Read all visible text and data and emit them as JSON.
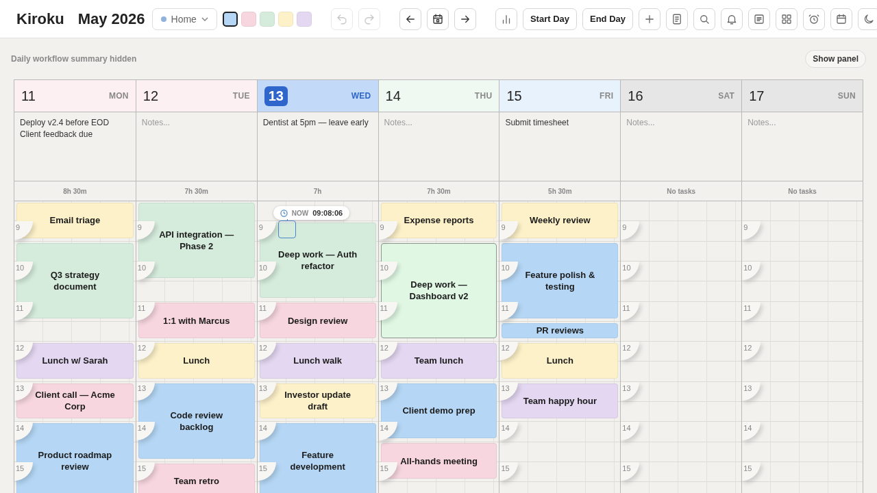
{
  "app": {
    "name": "Kiroku",
    "period": "May 2026"
  },
  "workspace": {
    "value": "Home"
  },
  "swatches": [
    {
      "color": "#b5d7f5",
      "selected": true
    },
    {
      "color": "#f7d6df",
      "selected": false
    },
    {
      "color": "#d5ebdc",
      "selected": false
    },
    {
      "color": "#fdf1c9",
      "selected": false
    },
    {
      "color": "#e3d7f1",
      "selected": false
    }
  ],
  "history": [
    {
      "kind": "icon",
      "disabled": true
    },
    {
      "kind": "icon",
      "disabled": true
    }
  ],
  "navigation": [
    {
      "kind": "icon"
    },
    {
      "kind": "icon"
    },
    {
      "kind": "icon"
    }
  ],
  "actions": [
    {
      "kind": "icon"
    },
    {
      "kind": "text",
      "label": "Start Day"
    },
    {
      "kind": "text",
      "label": "End Day"
    },
    {
      "kind": "icon"
    },
    {
      "kind": "icon"
    },
    {
      "kind": "icon"
    },
    {
      "kind": "icon"
    },
    {
      "kind": "icon"
    },
    {
      "kind": "icon"
    },
    {
      "kind": "icon"
    },
    {
      "kind": "icon"
    },
    {
      "kind": "icon"
    }
  ],
  "summary": {
    "text": "Daily workflow summary hidden",
    "button": "Show panel"
  },
  "days": [
    {
      "date": "11",
      "weekday": "MON",
      "color": "#fdf0f3",
      "today": false,
      "notes": "Deploy v2.4 before EOD\nClient feedback due",
      "total": "8h 30m",
      "hour_marks": [
        "9",
        "10",
        "11",
        "12",
        "13",
        "14",
        "15"
      ],
      "events": [
        {
          "title": "Email triage",
          "color": "#fdf1c9",
          "selected": false
        },
        {
          "title": "Q3 strategy document",
          "color": "#d5ebdc",
          "selected": false
        },
        {
          "title": "Lunch w/ Sarah",
          "color": "#e3d7f1",
          "selected": false
        },
        {
          "title": "Client call — Acme Corp",
          "color": "#f7d6df",
          "selected": false
        },
        {
          "title": "Product roadmap review",
          "color": "#b5d7f5",
          "selected": false
        }
      ]
    },
    {
      "date": "12",
      "weekday": "TUE",
      "color": "#fdf0f3",
      "today": false,
      "placeholder": "Notes...",
      "total": "7h 30m",
      "hour_marks": [
        "9",
        "10",
        "11",
        "12",
        "13",
        "14",
        "15"
      ],
      "events": [
        {
          "title": "API integration — Phase 2",
          "color": "#d5ebdc",
          "selected": false
        },
        {
          "title": "1:1 with Marcus",
          "color": "#f7d6df",
          "selected": false
        },
        {
          "title": "Lunch",
          "color": "#fdf1c9",
          "selected": false
        },
        {
          "title": "Code review backlog",
          "color": "#b5d7f5",
          "selected": false
        },
        {
          "title": "Team retro",
          "color": "#f7d6df",
          "selected": false
        }
      ]
    },
    {
      "date": "13",
      "weekday": "WED",
      "color": "#c2d9f7",
      "today": true,
      "notes": "Dentist at 5pm — leave early",
      "total": "7h",
      "hour_marks": [
        "9",
        "10",
        "11",
        "12",
        "13",
        "14",
        "15"
      ],
      "now": {
        "label": "NOW",
        "time": "09:08:06"
      },
      "events": [
        {
          "title": "Deep work — Auth refactor",
          "color": "#d5ebdc",
          "selected": false
        },
        {
          "title": "Design review",
          "color": "#f7d6df",
          "selected": false
        },
        {
          "title": "Lunch walk",
          "color": "#e3d7f1",
          "selected": false
        },
        {
          "title": "Investor update draft",
          "color": "#fdf1c9",
          "selected": false
        },
        {
          "title": "Feature development",
          "color": "#b5d7f5",
          "selected": false
        }
      ]
    },
    {
      "date": "14",
      "weekday": "THU",
      "color": "#eff8f1",
      "today": false,
      "placeholder": "Notes...",
      "total": "7h 30m",
      "hour_marks": [
        "9",
        "10",
        "11",
        "12",
        "13",
        "14",
        "15"
      ],
      "events": [
        {
          "title": "Expense reports",
          "color": "#fdf1c9",
          "selected": false
        },
        {
          "title": "Deep work — Dashboard v2",
          "color": "#dff7e3",
          "selected": true
        },
        {
          "title": "Team lunch",
          "color": "#e3d7f1",
          "selected": false
        },
        {
          "title": "Client demo prep",
          "color": "#b5d7f5",
          "selected": false
        },
        {
          "title": "All-hands meeting",
          "color": "#f7d6df",
          "selected": false
        }
      ]
    },
    {
      "date": "15",
      "weekday": "FRI",
      "color": "#e8f2fc",
      "today": false,
      "notes": "Submit timesheet",
      "total": "5h 30m",
      "hour_marks": [
        "9",
        "10",
        "11",
        "12",
        "13",
        "14",
        "15"
      ],
      "events": [
        {
          "title": "Weekly review",
          "color": "#fdf1c9",
          "selected": false
        },
        {
          "title": "Feature polish & testing",
          "color": "#b5d7f5",
          "selected": false
        },
        {
          "title": "PR reviews",
          "color": "#b5d7f5",
          "selected": false
        },
        {
          "title": "Lunch",
          "color": "#fdf1c9",
          "selected": false
        },
        {
          "title": "Team happy hour",
          "color": "#e3d7f1",
          "selected": false
        }
      ]
    },
    {
      "date": "16",
      "weekday": "SAT",
      "color": "#e6e6e6",
      "today": false,
      "placeholder": "Notes...",
      "total": "No tasks",
      "hour_marks": [
        "9",
        "10",
        "11",
        "12",
        "13",
        "14",
        "15"
      ]
    },
    {
      "date": "17",
      "weekday": "SUN",
      "color": "#e6e6e6",
      "today": false,
      "placeholder": "Notes...",
      "total": "No tasks",
      "hour_marks": [
        "9",
        "10",
        "11",
        "12",
        "13",
        "14",
        "15"
      ]
    }
  ]
}
